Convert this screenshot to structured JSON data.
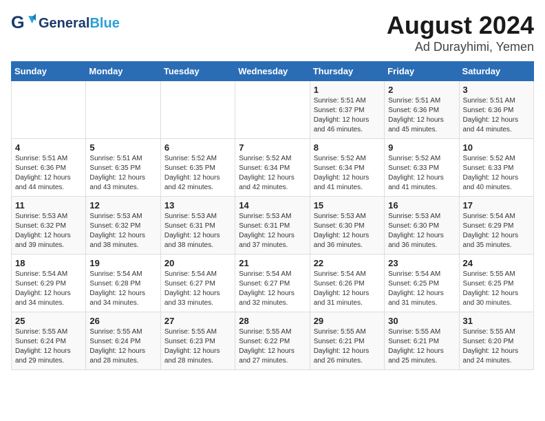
{
  "header": {
    "logo_text_general": "General",
    "logo_text_blue": "Blue",
    "title": "August 2024",
    "subtitle": "Ad Durayhimi, Yemen"
  },
  "weekdays": [
    "Sunday",
    "Monday",
    "Tuesday",
    "Wednesday",
    "Thursday",
    "Friday",
    "Saturday"
  ],
  "weeks": [
    [
      {
        "day": "",
        "detail": ""
      },
      {
        "day": "",
        "detail": ""
      },
      {
        "day": "",
        "detail": ""
      },
      {
        "day": "",
        "detail": ""
      },
      {
        "day": "1",
        "detail": "Sunrise: 5:51 AM\nSunset: 6:37 PM\nDaylight: 12 hours\nand 46 minutes."
      },
      {
        "day": "2",
        "detail": "Sunrise: 5:51 AM\nSunset: 6:36 PM\nDaylight: 12 hours\nand 45 minutes."
      },
      {
        "day": "3",
        "detail": "Sunrise: 5:51 AM\nSunset: 6:36 PM\nDaylight: 12 hours\nand 44 minutes."
      }
    ],
    [
      {
        "day": "4",
        "detail": "Sunrise: 5:51 AM\nSunset: 6:36 PM\nDaylight: 12 hours\nand 44 minutes."
      },
      {
        "day": "5",
        "detail": "Sunrise: 5:51 AM\nSunset: 6:35 PM\nDaylight: 12 hours\nand 43 minutes."
      },
      {
        "day": "6",
        "detail": "Sunrise: 5:52 AM\nSunset: 6:35 PM\nDaylight: 12 hours\nand 42 minutes."
      },
      {
        "day": "7",
        "detail": "Sunrise: 5:52 AM\nSunset: 6:34 PM\nDaylight: 12 hours\nand 42 minutes."
      },
      {
        "day": "8",
        "detail": "Sunrise: 5:52 AM\nSunset: 6:34 PM\nDaylight: 12 hours\nand 41 minutes."
      },
      {
        "day": "9",
        "detail": "Sunrise: 5:52 AM\nSunset: 6:33 PM\nDaylight: 12 hours\nand 41 minutes."
      },
      {
        "day": "10",
        "detail": "Sunrise: 5:52 AM\nSunset: 6:33 PM\nDaylight: 12 hours\nand 40 minutes."
      }
    ],
    [
      {
        "day": "11",
        "detail": "Sunrise: 5:53 AM\nSunset: 6:32 PM\nDaylight: 12 hours\nand 39 minutes."
      },
      {
        "day": "12",
        "detail": "Sunrise: 5:53 AM\nSunset: 6:32 PM\nDaylight: 12 hours\nand 38 minutes."
      },
      {
        "day": "13",
        "detail": "Sunrise: 5:53 AM\nSunset: 6:31 PM\nDaylight: 12 hours\nand 38 minutes."
      },
      {
        "day": "14",
        "detail": "Sunrise: 5:53 AM\nSunset: 6:31 PM\nDaylight: 12 hours\nand 37 minutes."
      },
      {
        "day": "15",
        "detail": "Sunrise: 5:53 AM\nSunset: 6:30 PM\nDaylight: 12 hours\nand 36 minutes."
      },
      {
        "day": "16",
        "detail": "Sunrise: 5:53 AM\nSunset: 6:30 PM\nDaylight: 12 hours\nand 36 minutes."
      },
      {
        "day": "17",
        "detail": "Sunrise: 5:54 AM\nSunset: 6:29 PM\nDaylight: 12 hours\nand 35 minutes."
      }
    ],
    [
      {
        "day": "18",
        "detail": "Sunrise: 5:54 AM\nSunset: 6:29 PM\nDaylight: 12 hours\nand 34 minutes."
      },
      {
        "day": "19",
        "detail": "Sunrise: 5:54 AM\nSunset: 6:28 PM\nDaylight: 12 hours\nand 34 minutes."
      },
      {
        "day": "20",
        "detail": "Sunrise: 5:54 AM\nSunset: 6:27 PM\nDaylight: 12 hours\nand 33 minutes."
      },
      {
        "day": "21",
        "detail": "Sunrise: 5:54 AM\nSunset: 6:27 PM\nDaylight: 12 hours\nand 32 minutes."
      },
      {
        "day": "22",
        "detail": "Sunrise: 5:54 AM\nSunset: 6:26 PM\nDaylight: 12 hours\nand 31 minutes."
      },
      {
        "day": "23",
        "detail": "Sunrise: 5:54 AM\nSunset: 6:25 PM\nDaylight: 12 hours\nand 31 minutes."
      },
      {
        "day": "24",
        "detail": "Sunrise: 5:55 AM\nSunset: 6:25 PM\nDaylight: 12 hours\nand 30 minutes."
      }
    ],
    [
      {
        "day": "25",
        "detail": "Sunrise: 5:55 AM\nSunset: 6:24 PM\nDaylight: 12 hours\nand 29 minutes."
      },
      {
        "day": "26",
        "detail": "Sunrise: 5:55 AM\nSunset: 6:24 PM\nDaylight: 12 hours\nand 28 minutes."
      },
      {
        "day": "27",
        "detail": "Sunrise: 5:55 AM\nSunset: 6:23 PM\nDaylight: 12 hours\nand 28 minutes."
      },
      {
        "day": "28",
        "detail": "Sunrise: 5:55 AM\nSunset: 6:22 PM\nDaylight: 12 hours\nand 27 minutes."
      },
      {
        "day": "29",
        "detail": "Sunrise: 5:55 AM\nSunset: 6:21 PM\nDaylight: 12 hours\nand 26 minutes."
      },
      {
        "day": "30",
        "detail": "Sunrise: 5:55 AM\nSunset: 6:21 PM\nDaylight: 12 hours\nand 25 minutes."
      },
      {
        "day": "31",
        "detail": "Sunrise: 5:55 AM\nSunset: 6:20 PM\nDaylight: 12 hours\nand 24 minutes."
      }
    ]
  ]
}
